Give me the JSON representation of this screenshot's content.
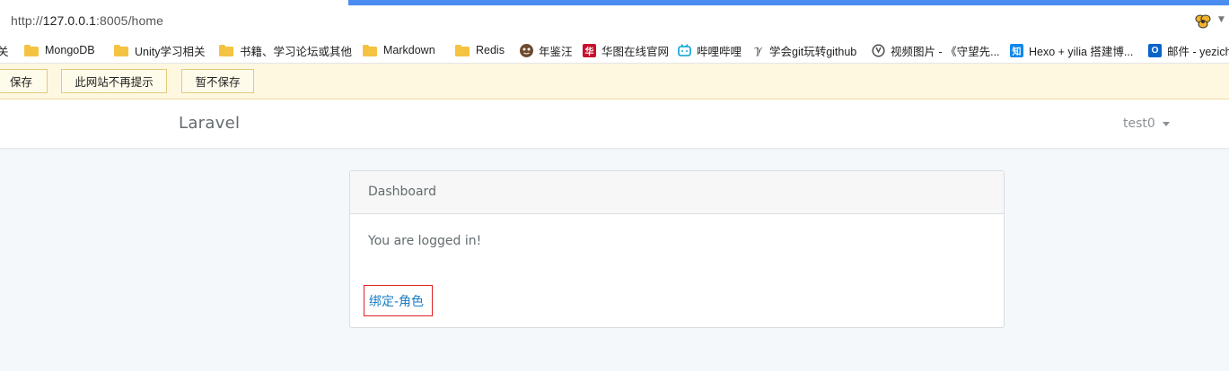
{
  "browser": {
    "url_prefix": "http://",
    "url_host": "127.0.0.1",
    "url_rest": ":8005/home",
    "load_progress_pct": 72
  },
  "bookmarks": [
    {
      "label": "关",
      "icon": "none"
    },
    {
      "label": "MongoDB",
      "icon": "folder-icon"
    },
    {
      "label": "Unity学习相关",
      "icon": "folder-icon"
    },
    {
      "label": "书籍、学习论坛或其他",
      "icon": "folder-icon"
    },
    {
      "label": "Markdown",
      "icon": "folder-icon"
    },
    {
      "label": "Redis",
      "icon": "folder-icon"
    },
    {
      "label": "年鉴汪",
      "icon": "avatar-icon"
    },
    {
      "label": "华图在线官网",
      "icon": "huatu-icon"
    },
    {
      "label": "哔哩哔哩",
      "icon": "bilibili-icon"
    },
    {
      "label": "学会git玩转github",
      "icon": "git-icon"
    },
    {
      "label": "视频图片 - 《守望先...",
      "icon": "overwatch-icon"
    },
    {
      "label": "Hexo + yilia 搭建博...",
      "icon": "zhihu-icon"
    },
    {
      "label": "邮件 - yezich",
      "icon": "outlook-icon"
    }
  ],
  "password_bar": {
    "save": "保存",
    "never": "此网站不再提示",
    "not_now": "暂不保存"
  },
  "navbar": {
    "brand": "Laravel",
    "user": "test0"
  },
  "card": {
    "header": "Dashboard",
    "message": "You are logged in!",
    "link": "绑定-角色"
  },
  "colors": {
    "accent_link": "#1a7ec4",
    "highlight_border": "#e02020",
    "progress": "#4a8cf0",
    "folder": "#f5c342"
  }
}
